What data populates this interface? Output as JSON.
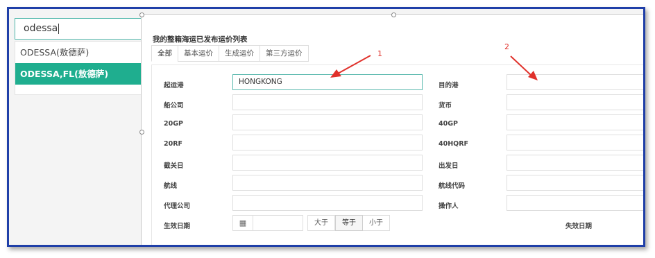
{
  "search": {
    "value": "odessa"
  },
  "dropdown": {
    "items": [
      {
        "label": "ODESSA(敖德萨)"
      },
      {
        "label": "ODESSA,FL(敖德萨)"
      }
    ]
  },
  "panel": {
    "title": "我的整箱海运已发布运价列表",
    "tabs": [
      {
        "label": "全部"
      },
      {
        "label": "基本运价"
      },
      {
        "label": "生成运价"
      },
      {
        "label": "第三方运价"
      }
    ]
  },
  "form": {
    "left": [
      {
        "label": "起运港",
        "value": "HONGKONG"
      },
      {
        "label": "船公司",
        "value": ""
      },
      {
        "label": "20GP",
        "value": ""
      },
      {
        "label": "20RF",
        "value": ""
      },
      {
        "label": "截关日",
        "value": ""
      },
      {
        "label": "航线",
        "value": ""
      },
      {
        "label": "代理公司",
        "value": ""
      }
    ],
    "right": [
      {
        "label": "目的港",
        "value": ""
      },
      {
        "label": "货币",
        "value": ""
      },
      {
        "label": "40GP",
        "value": ""
      },
      {
        "label": "40HQRF",
        "value": ""
      },
      {
        "label": "出发日",
        "value": ""
      },
      {
        "label": "航线代码",
        "value": ""
      },
      {
        "label": "操作人",
        "value": ""
      }
    ],
    "effective_date_label": "生效日期",
    "expiry_date_label": "失效日期",
    "compare_options": [
      "大于",
      "等于",
      "小于"
    ],
    "compare_selected": "等于"
  },
  "annotations": {
    "first": "1",
    "second": "2"
  },
  "colors": {
    "accent": "#1fae8f",
    "frame": "#1f3fa8",
    "arrow": "#e0312b",
    "focus": "#58b8ad"
  },
  "icons": {
    "calendar": "calendar-icon"
  }
}
